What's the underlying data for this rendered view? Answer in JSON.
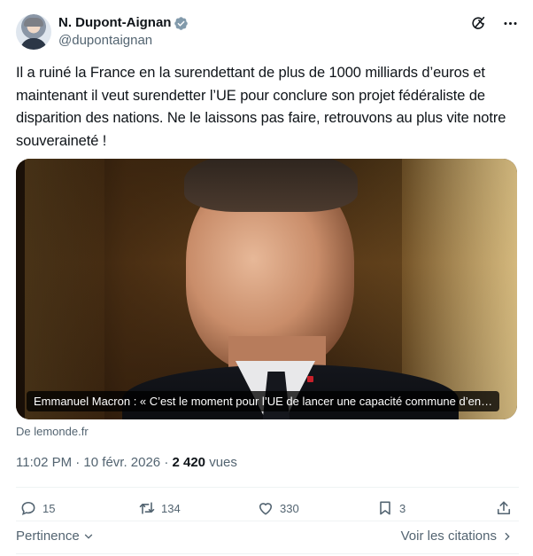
{
  "author": {
    "display_name": "N. Dupont-Aignan",
    "handle": "@dupontaignan",
    "verified_color": "#829aab"
  },
  "header_icons": [
    "grok-icon",
    "more-icon"
  ],
  "tweet": {
    "text": "Il a ruiné la France en la surendettant de plus de 1000 milliards d’euros et maintenant il veut surendetter l’UE pour conclure son projet fédéraliste de disparition des nations. Ne le laissons pas faire, retrouvons au plus vite notre souveraineté !"
  },
  "card": {
    "caption": "Emmanuel Macron : « C’est le moment pour l’UE de lancer une capacité commune d’en…",
    "source": "De lemonde.fr"
  },
  "meta": {
    "time": "11:02 PM · 10 févr. 2026 · ",
    "views_count": "2 420",
    "views_label": " vues"
  },
  "actions": {
    "replies": "15",
    "reposts": "134",
    "likes": "330",
    "bookmarks": "3"
  },
  "footer": {
    "relevance_label": "Pertinence",
    "quotes_label": "Voir les citations"
  },
  "colors": {
    "text": "#0f1419",
    "secondary": "#536471",
    "divider": "#eff3f4"
  }
}
